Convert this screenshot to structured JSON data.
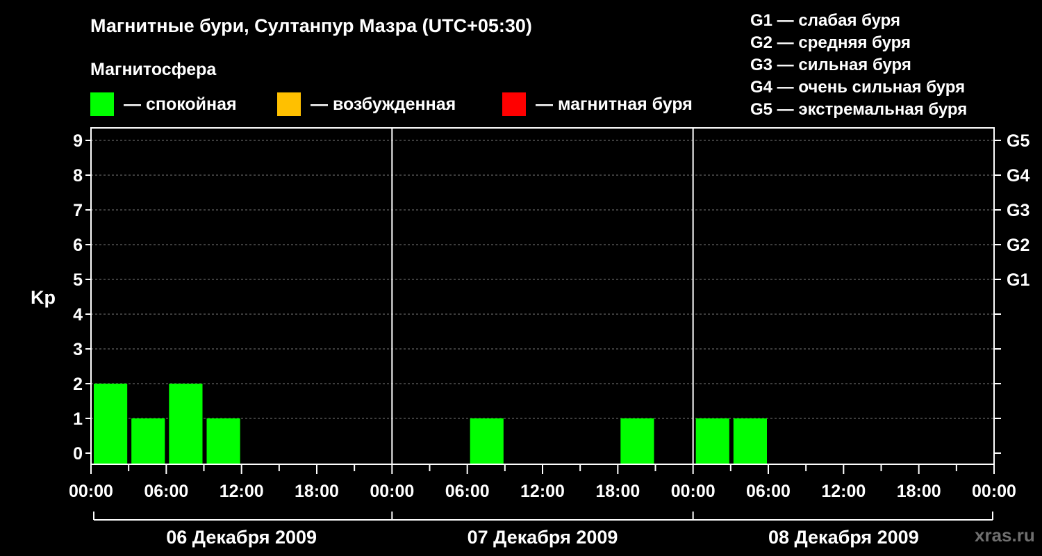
{
  "title": "Магнитные бури, Султанпур Мазра (UTC+05:30)",
  "subtitle": "Магнитосфера",
  "legend": [
    {
      "label": "— спокойная",
      "color": "#00ff00"
    },
    {
      "label": "— возбужденная",
      "color": "#ffc000"
    },
    {
      "label": "— магнитная буря",
      "color": "#ff0000"
    }
  ],
  "g_scale": [
    "G1 — слабая буря",
    "G2 — средняя буря",
    "G3 — сильная буря",
    "G4 — очень сильная буря",
    "G5 — экстремальная буря"
  ],
  "watermark": "xras.ru",
  "chart_data": {
    "type": "bar",
    "ylabel": "Kp",
    "ylim": [
      0,
      9
    ],
    "y_ticks": [
      0,
      1,
      2,
      3,
      4,
      5,
      6,
      7,
      8,
      9
    ],
    "right_ticks": [
      {
        "value": 5,
        "label": "G1"
      },
      {
        "value": 6,
        "label": "G2"
      },
      {
        "value": 7,
        "label": "G3"
      },
      {
        "value": 8,
        "label": "G4"
      },
      {
        "value": 9,
        "label": "G5"
      }
    ],
    "x_tick_labels": [
      "00:00",
      "06:00",
      "12:00",
      "18:00",
      "00:00",
      "06:00",
      "12:00",
      "18:00",
      "00:00",
      "06:00",
      "12:00",
      "18:00",
      "00:00"
    ],
    "days": [
      "06 Декабря 2009",
      "07 Декабря 2009",
      "08 Декабря 2009"
    ],
    "grid": true,
    "bars": [
      {
        "day": 0,
        "start_hour": 0,
        "kp": 2,
        "color": "#00ff00"
      },
      {
        "day": 0,
        "start_hour": 3,
        "kp": 1,
        "color": "#00ff00"
      },
      {
        "day": 0,
        "start_hour": 6,
        "kp": 2,
        "color": "#00ff00"
      },
      {
        "day": 0,
        "start_hour": 9,
        "kp": 1,
        "color": "#00ff00"
      },
      {
        "day": 1,
        "start_hour": 6,
        "kp": 1,
        "color": "#00ff00"
      },
      {
        "day": 1,
        "start_hour": 18,
        "kp": 1,
        "color": "#00ff00"
      },
      {
        "day": 2,
        "start_hour": 0,
        "kp": 1,
        "color": "#00ff00"
      },
      {
        "day": 2,
        "start_hour": 3,
        "kp": 1,
        "color": "#00ff00"
      }
    ]
  }
}
